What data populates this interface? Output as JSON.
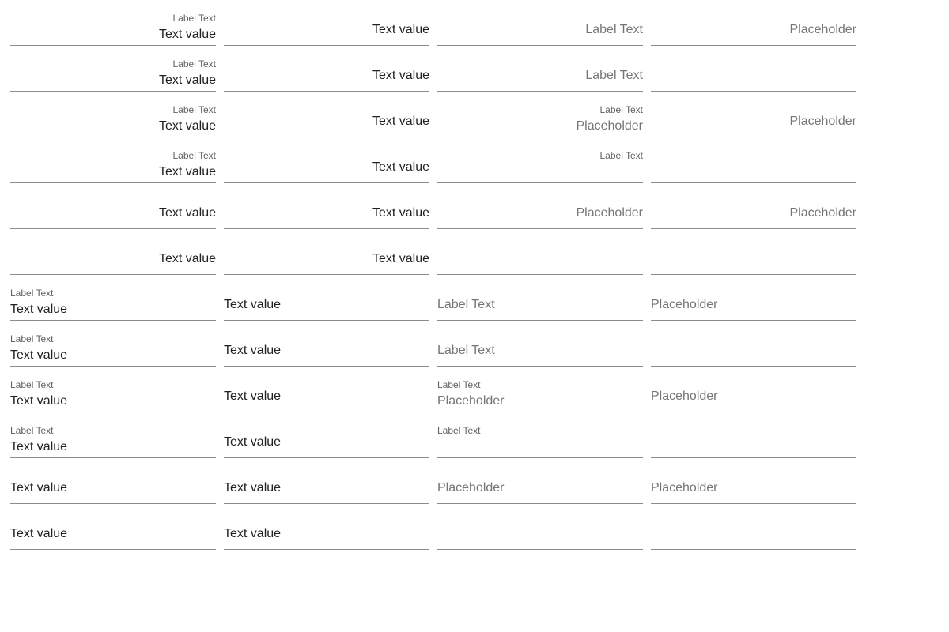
{
  "colors": {
    "text": "#212121",
    "hint": "#757575",
    "label": "#616161",
    "underline": "#8c8c8c"
  },
  "rows": [
    {
      "dir": "rtl",
      "cells": [
        {
          "label": "Label Text",
          "value": "Text value"
        },
        {
          "label": "",
          "value": "Text value"
        },
        {
          "label": "",
          "value": "",
          "hint": "Label Text"
        },
        {
          "label": "",
          "value": "",
          "hint": "Placeholder"
        }
      ]
    },
    {
      "dir": "rtl",
      "cells": [
        {
          "label": "Label Text",
          "value": "Text value"
        },
        {
          "label": "",
          "value": "Text value"
        },
        {
          "label": "",
          "value": "",
          "hint": "Label Text"
        },
        {
          "label": "",
          "value": "",
          "hint": ""
        }
      ]
    },
    {
      "dir": "rtl",
      "cells": [
        {
          "label": "Label Text",
          "value": "Text value"
        },
        {
          "label": "",
          "value": "Text value"
        },
        {
          "label": "Label Text",
          "value": "",
          "hint": "Placeholder"
        },
        {
          "label": "",
          "value": "",
          "hint": "Placeholder"
        }
      ]
    },
    {
      "dir": "rtl",
      "cells": [
        {
          "label": "Label Text",
          "value": "Text value"
        },
        {
          "label": "",
          "value": "Text value"
        },
        {
          "label": "Label Text",
          "value": "",
          "hint": ""
        },
        {
          "label": "",
          "value": "",
          "hint": ""
        }
      ]
    },
    {
      "dir": "rtl",
      "cells": [
        {
          "label": "",
          "value": "Text value"
        },
        {
          "label": "",
          "value": "Text value"
        },
        {
          "label": "",
          "value": "",
          "hint": "Placeholder"
        },
        {
          "label": "",
          "value": "",
          "hint": "Placeholder"
        }
      ]
    },
    {
      "dir": "rtl",
      "cells": [
        {
          "label": "",
          "value": "Text value"
        },
        {
          "label": "",
          "value": "Text value"
        },
        {
          "label": "",
          "value": "",
          "hint": ""
        },
        {
          "label": "",
          "value": "",
          "hint": ""
        }
      ]
    },
    {
      "dir": "ltr",
      "cells": [
        {
          "label": "Label Text",
          "value": "Text value"
        },
        {
          "label": "",
          "value": "Text value"
        },
        {
          "label": "",
          "value": "",
          "hint": "Label Text"
        },
        {
          "label": "",
          "value": "",
          "hint": "Placeholder"
        }
      ]
    },
    {
      "dir": "ltr",
      "cells": [
        {
          "label": "Label Text",
          "value": "Text value"
        },
        {
          "label": "",
          "value": "Text value"
        },
        {
          "label": "",
          "value": "",
          "hint": "Label Text"
        },
        {
          "label": "",
          "value": "",
          "hint": ""
        }
      ]
    },
    {
      "dir": "ltr",
      "cells": [
        {
          "label": "Label Text",
          "value": "Text value"
        },
        {
          "label": "",
          "value": "Text value"
        },
        {
          "label": "Label Text",
          "value": "",
          "hint": "Placeholder"
        },
        {
          "label": "",
          "value": "",
          "hint": "Placeholder"
        }
      ]
    },
    {
      "dir": "ltr",
      "cells": [
        {
          "label": "Label Text",
          "value": "Text value"
        },
        {
          "label": "",
          "value": "Text value"
        },
        {
          "label": "Label Text",
          "value": "",
          "hint": ""
        },
        {
          "label": "",
          "value": "",
          "hint": ""
        }
      ]
    },
    {
      "dir": "ltr",
      "cells": [
        {
          "label": "",
          "value": "Text value"
        },
        {
          "label": "",
          "value": "Text value"
        },
        {
          "label": "",
          "value": "",
          "hint": "Placeholder"
        },
        {
          "label": "",
          "value": "",
          "hint": "Placeholder"
        }
      ]
    },
    {
      "dir": "ltr",
      "cells": [
        {
          "label": "",
          "value": "Text value"
        },
        {
          "label": "",
          "value": "Text value"
        },
        {
          "label": "",
          "value": "",
          "hint": ""
        },
        {
          "label": "",
          "value": "",
          "hint": ""
        }
      ]
    }
  ]
}
